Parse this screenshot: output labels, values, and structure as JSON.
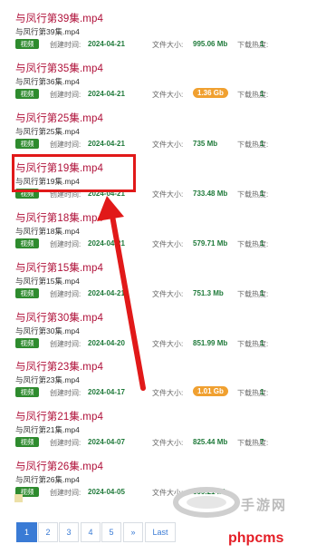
{
  "files": [
    {
      "title": "与凤行第39集.mp4",
      "subtitle": "与凤行第39集.mp4",
      "badge": "视频",
      "created_label": "创建时间:",
      "created": "2024-04-21",
      "size_label": "文件大小:",
      "size": "995.06 Mb",
      "size_highlight": false,
      "hot_label": "下载热度:",
      "hot": "1"
    },
    {
      "title": "与凤行第35集.mp4",
      "subtitle": "与凤行第36集.mp4",
      "badge": "视频",
      "created_label": "创建时间:",
      "created": "2024-04-21",
      "size_label": "文件大小:",
      "size": "1.36 Gb",
      "size_highlight": true,
      "hot_label": "下载热度:",
      "hot": "1"
    },
    {
      "title": "与凤行第25集.mp4",
      "subtitle": "与凤行第25集.mp4",
      "badge": "视频",
      "created_label": "创建时间:",
      "created": "2024-04-21",
      "size_label": "文件大小:",
      "size": "735 Mb",
      "size_highlight": false,
      "hot_label": "下载热度:",
      "hot": "1"
    },
    {
      "title": "与凤行第19集.mp4",
      "subtitle": "与凤行第19集.mp4",
      "badge": "视频",
      "created_label": "创建时间:",
      "created": "2024-04-21",
      "size_label": "文件大小:",
      "size": "733.48 Mb",
      "size_highlight": false,
      "hot_label": "下载热度:",
      "hot": "1"
    },
    {
      "title": "与凤行第18集.mp4",
      "subtitle": "与凤行第18集.mp4",
      "badge": "视频",
      "created_label": "创建时间:",
      "created": "2024-04-21",
      "size_label": "文件大小:",
      "size": "579.71 Mb",
      "size_highlight": false,
      "hot_label": "下载热度:",
      "hot": "1"
    },
    {
      "title": "与凤行第15集.mp4",
      "subtitle": "与凤行第15集.mp4",
      "badge": "视频",
      "created_label": "创建时间:",
      "created": "2024-04-21",
      "size_label": "文件大小:",
      "size": "751.3 Mb",
      "size_highlight": false,
      "hot_label": "下载热度:",
      "hot": "1"
    },
    {
      "title": "与凤行第30集.mp4",
      "subtitle": "与凤行第30集.mp4",
      "badge": "视频",
      "created_label": "创建时间:",
      "created": "2024-04-20",
      "size_label": "文件大小:",
      "size": "851.99 Mb",
      "size_highlight": false,
      "hot_label": "下载热度:",
      "hot": "1"
    },
    {
      "title": "与凤行第23集.mp4",
      "subtitle": "与凤行第23集.mp4",
      "badge": "视频",
      "created_label": "创建时间:",
      "created": "2024-04-17",
      "size_label": "文件大小:",
      "size": "1.01 Gb",
      "size_highlight": true,
      "hot_label": "下载热度:",
      "hot": "1"
    },
    {
      "title": "与凤行第21集.mp4",
      "subtitle": "与凤行第21集.mp4",
      "badge": "视频",
      "created_label": "创建时间:",
      "created": "2024-04-07",
      "size_label": "文件大小:",
      "size": "825.44 Mb",
      "size_highlight": false,
      "hot_label": "下载热度:",
      "hot": "7"
    },
    {
      "title": "与凤行第26集.mp4",
      "subtitle": "与凤行第26集.mp4",
      "badge": "视频",
      "created_label": "创建时间:",
      "created": "2024-04-05",
      "size_label": "文件大小:",
      "size": "599.21 Mb",
      "size_highlight": false,
      "hot_label": "",
      "hot": ""
    }
  ],
  "pagination": {
    "pages": [
      "1",
      "2",
      "3",
      "4",
      "5",
      "»",
      "Last"
    ],
    "active": "1"
  },
  "colors": {
    "accent": "#3a7bd5",
    "title": "#b0113a",
    "badge": "#2e8b2e",
    "highlight_size": "#f0a030",
    "annotation": "#e11919"
  },
  "watermark": {
    "site_text": "手游网",
    "brand_text": "phpcms"
  }
}
